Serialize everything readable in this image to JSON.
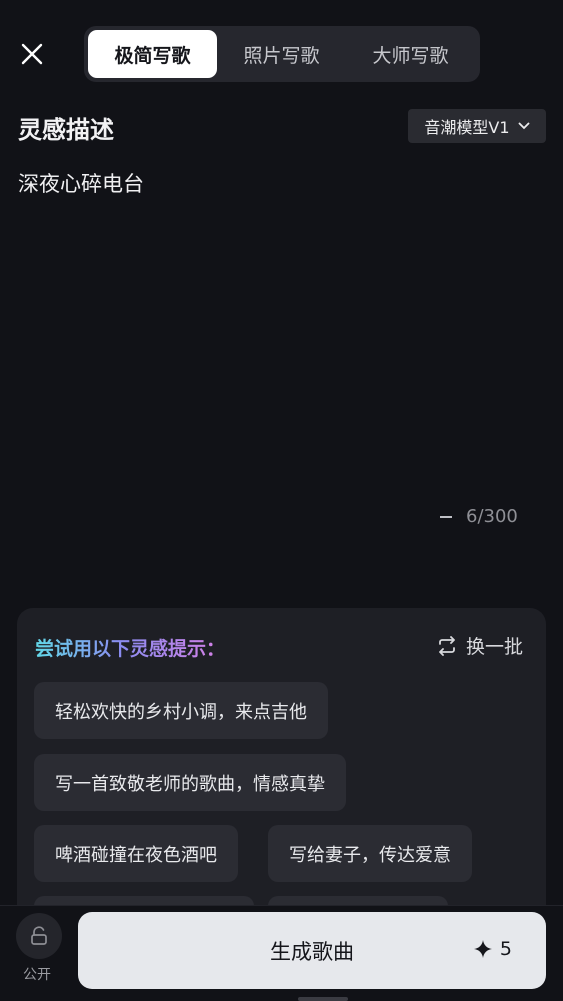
{
  "header": {
    "tabs": [
      {
        "label": "极简写歌",
        "active": true
      },
      {
        "label": "照片写歌",
        "active": false
      },
      {
        "label": "大师写歌",
        "active": false
      }
    ]
  },
  "inspiration": {
    "title": "灵感描述",
    "model_select": "音潮模型V1",
    "text": "深夜心碎电台",
    "char_count": "6/300"
  },
  "suggestions": {
    "title": "尝试用以下灵感提示：",
    "refresh_label": "换一批",
    "items": [
      "轻松欢快的乡村小调，来点吉他",
      "写一首致敬老师的歌曲，情感真挚",
      "啤酒碰撞在夜色酒吧",
      "写给妻子，传达爱意"
    ]
  },
  "footer": {
    "public_label": "公开",
    "generate_label": "生成歌曲",
    "credit_count": "5"
  },
  "colors": {
    "background": "#111217",
    "accent_gradient": [
      "#62d8e8",
      "#8b8cf0",
      "#d67fe6"
    ],
    "button": "#e6e8ec"
  }
}
